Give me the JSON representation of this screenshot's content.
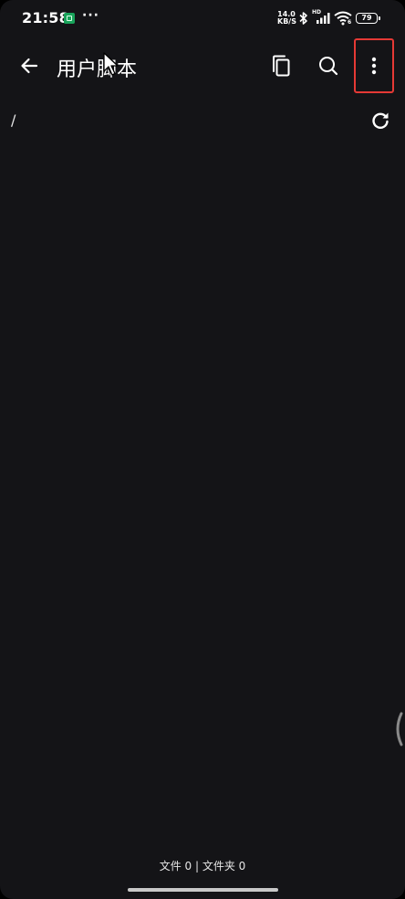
{
  "status_bar": {
    "time": "21:58",
    "more_notifications": "···",
    "network_speed_value": "14.0",
    "network_speed_unit": "KB/S",
    "network_type": "HD",
    "wifi_badge": "6",
    "battery_level": "79"
  },
  "toolbar": {
    "title": "用户脚本",
    "icons": {
      "back": "arrow-left-icon",
      "copy": "copy-icon",
      "search": "search-icon",
      "more": "more-vertical-icon"
    },
    "highlight_color": "#e53935"
  },
  "path": {
    "current": "/",
    "refresh_icon": "refresh-icon"
  },
  "footer": {
    "summary": "文件 0 | 文件夹 0"
  },
  "colors": {
    "background": "#141417",
    "text": "#ffffff"
  }
}
